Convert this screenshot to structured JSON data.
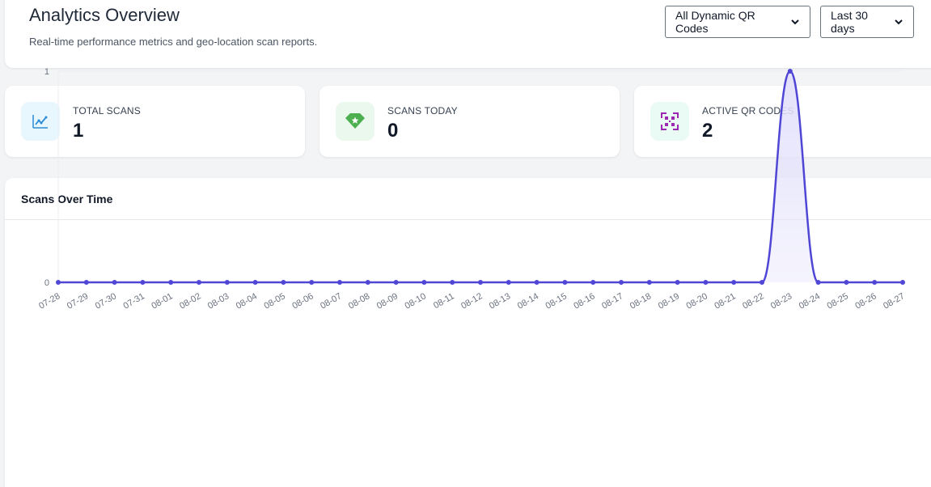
{
  "header": {
    "title": "Analytics Overview",
    "subtitle": "Real-time performance metrics and geo-location scan reports.",
    "qr_filter": "All Dynamic QR Codes",
    "range_filter": "Last 30 days"
  },
  "stats": [
    {
      "label": "TOTAL SCANS",
      "value": "1",
      "icon": "trend-chart-icon",
      "color": "#2a8bd6",
      "bg": "#e8f7fd"
    },
    {
      "label": "SCANS TODAY",
      "value": "0",
      "icon": "diamond-star-icon",
      "color": "#4caf50",
      "bg": "#eaf8ee"
    },
    {
      "label": "ACTIVE QR CODES",
      "value": "2",
      "icon": "qr-scan-icon",
      "color": "#9c27b0",
      "bg": "#eafaf5"
    }
  ],
  "chart": {
    "title": "Scans Over Time"
  },
  "chart_data": {
    "type": "area",
    "x": [
      "07-28",
      "07-29",
      "07-30",
      "07-31",
      "08-01",
      "08-02",
      "08-03",
      "08-04",
      "08-05",
      "08-06",
      "08-07",
      "08-08",
      "08-09",
      "08-10",
      "08-11",
      "08-12",
      "08-13",
      "08-14",
      "08-15",
      "08-16",
      "08-17",
      "08-18",
      "08-19",
      "08-20",
      "08-21",
      "08-22",
      "08-23",
      "08-24",
      "08-25",
      "08-26",
      "08-27"
    ],
    "values": [
      0,
      0,
      0,
      0,
      0,
      0,
      0,
      0,
      0,
      0,
      0,
      0,
      0,
      0,
      0,
      0,
      0,
      0,
      0,
      0,
      0,
      0,
      0,
      0,
      0,
      0,
      1,
      0,
      0,
      0,
      0
    ],
    "ylim": [
      0,
      1
    ],
    "yticks": [
      "0",
      "1"
    ],
    "line_color": "#5046d6",
    "fill_color": "#e3e1fb",
    "grid": true
  }
}
